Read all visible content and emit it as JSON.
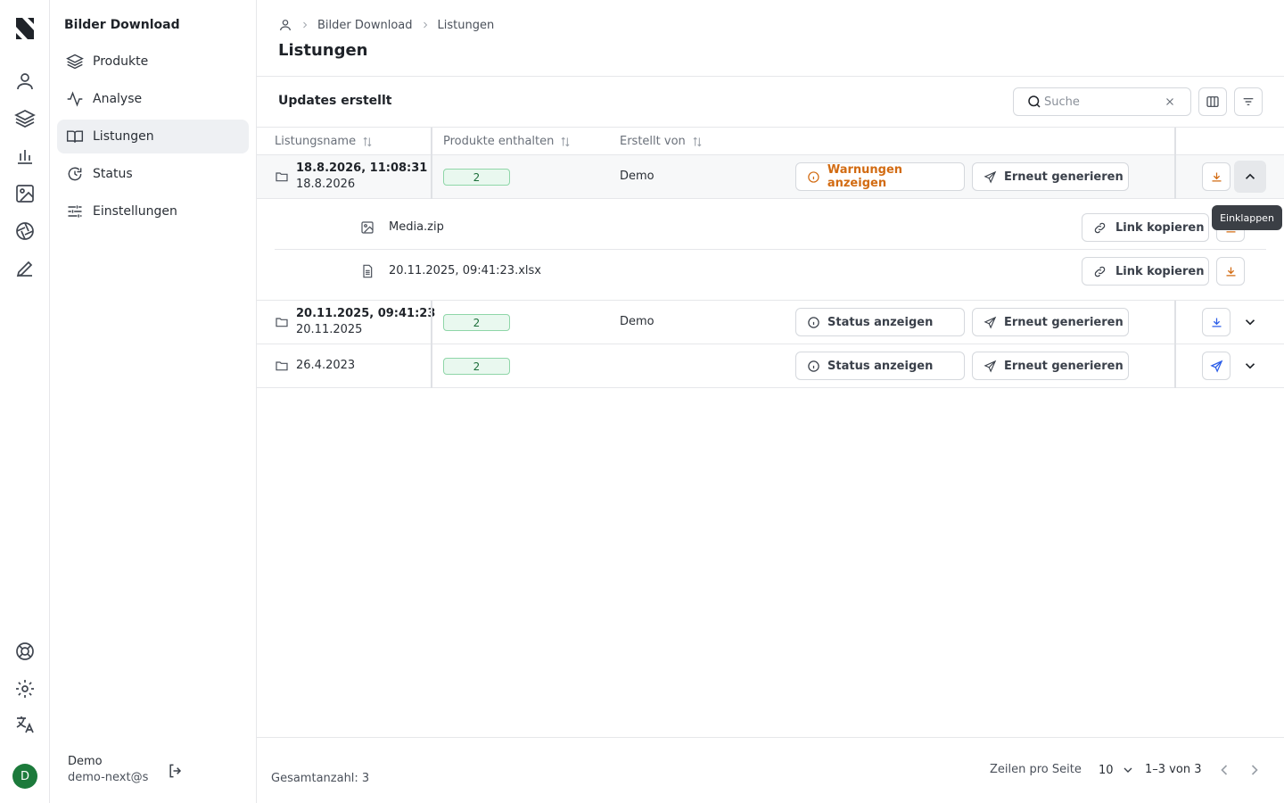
{
  "app": {
    "section_title": "Bilder Download"
  },
  "colors": {
    "accent_green": "#1c7a3b",
    "warning_orange": "#d26b12",
    "link_blue": "#2c5ee8",
    "badge_green": "#e9f8ef"
  },
  "rail": {
    "icons": [
      "logo-icon",
      "user-icon",
      "layers-icon",
      "bar-chart-icon",
      "image-icon",
      "aperture-icon",
      "pen-icon",
      "lifebuoy-icon",
      "gear-icon",
      "translate-icon"
    ],
    "avatar_initial": "D"
  },
  "nav": {
    "items": [
      {
        "label": "Produkte",
        "icon": "layers-icon"
      },
      {
        "label": "Analyse",
        "icon": "activity-icon"
      },
      {
        "label": "Listungen",
        "icon": "book-open-icon",
        "active": true
      },
      {
        "label": "Status",
        "icon": "refresh-icon"
      },
      {
        "label": "Einstellungen",
        "icon": "sliders-icon"
      }
    ]
  },
  "user": {
    "name": "Demo",
    "email": "demo-next@s"
  },
  "breadcrumb": {
    "items": [
      "Bilder Download",
      "Listungen"
    ]
  },
  "page": {
    "title": "Listungen"
  },
  "toolbar": {
    "title": "Updates erstellt",
    "search_placeholder": "Suche"
  },
  "table": {
    "columns": [
      "Listungsname",
      "Produkte enthalten",
      "Erstellt von"
    ],
    "rows": [
      {
        "name": "18.8.2026, 11:08:31",
        "date": "18.8.2026",
        "products": "2",
        "creator": "Demo",
        "status_label": "Warnungen anzeigen",
        "status_kind": "warning",
        "regen_label": "Erneut generieren",
        "expanded": true,
        "files": [
          {
            "name": "Media.zip",
            "icon": "image-icon",
            "copy_label": "Link kopieren"
          },
          {
            "name": "20.11.2025, 09:41:23.xlsx",
            "icon": "spreadsheet-icon",
            "copy_label": "Link kopieren"
          }
        ]
      },
      {
        "name": "20.11.2025, 09:41:23",
        "date": "20.11.2025",
        "products": "2",
        "creator": "Demo",
        "status_label": "Status anzeigen",
        "status_kind": "info",
        "regen_label": "Erneut generieren",
        "expanded": false
      },
      {
        "name": "26.4.2023",
        "date": "",
        "products": "2",
        "creator": "",
        "status_label": "Status anzeigen",
        "status_kind": "info",
        "regen_label": "Erneut generieren",
        "expanded": false
      }
    ]
  },
  "tooltip": {
    "text": "Einklappen"
  },
  "footer": {
    "total": "Gesamtanzahl: 3",
    "rows_per_page_label": "Zeilen pro Seite",
    "rows_per_page": "10",
    "range": "1–3 von 3"
  }
}
